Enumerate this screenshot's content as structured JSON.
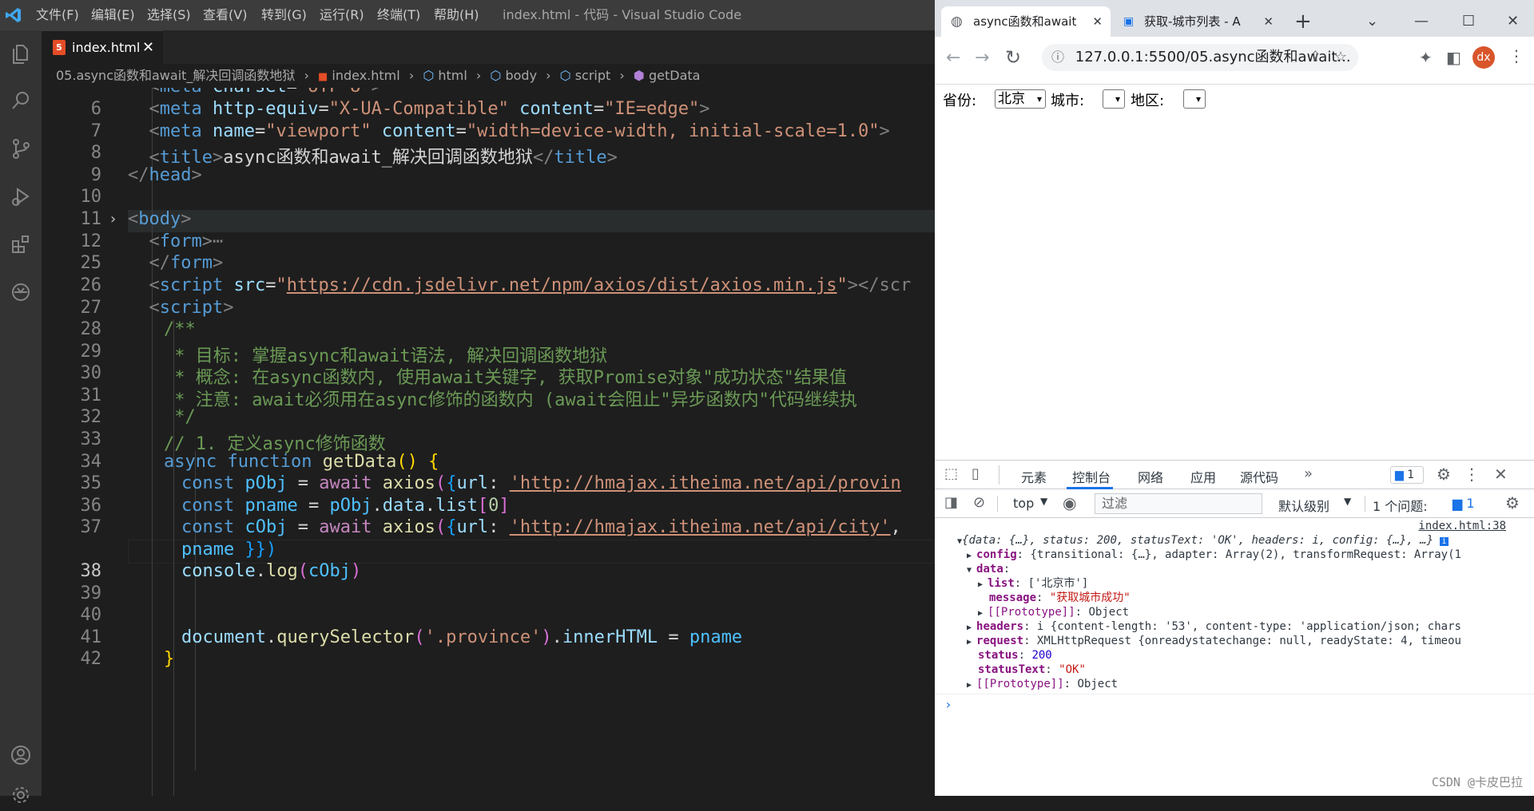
{
  "vscode": {
    "window_title": "index.html - 代码 - Visual Studio Code",
    "menu": [
      "文件(F)",
      "编辑(E)",
      "选择(S)",
      "查看(V)",
      "转到(G)",
      "运行(R)",
      "终端(T)",
      "帮助(H)"
    ],
    "tab": {
      "label": "index.html"
    },
    "breadcrumb": [
      "05.async函数和await_解决回调函数地狱",
      "index.html",
      "html",
      "body",
      "script",
      "getData"
    ],
    "line_numbers": [
      "6",
      "7",
      "8",
      "9",
      "10",
      "11",
      "12",
      "25",
      "26",
      "27",
      "28",
      "29",
      "30",
      "31",
      "32",
      "33",
      "34",
      "35",
      "36",
      "37",
      "",
      "38",
      "39",
      "40",
      "41",
      "42"
    ],
    "current_line": "38",
    "code": {
      "l6": {
        "tag": "meta",
        "a1": "http-equiv",
        "v1": "\"X-UA-Compatible\"",
        "a2": "content",
        "v2": "\"IE=edge\""
      },
      "l7": {
        "tag": "meta",
        "a1": "name",
        "v1": "\"viewport\"",
        "a2": "content",
        "v2": "\"width=device-width, initial-scale=1.0\""
      },
      "l8": {
        "tag": "title",
        "text": "async函数和await_解决回调函数地狱"
      },
      "l9": {
        "tag": "head"
      },
      "l11": {
        "tag": "body"
      },
      "l12": {
        "tag": "form",
        "fold": "⋯"
      },
      "l25": {
        "tag": "form"
      },
      "l26": {
        "tag": "script",
        "attr": "src",
        "url": "https://cdn.jsdelivr.net/npm/axios/dist/axios.min.js",
        "tail": "></scr"
      },
      "l27": {
        "tag": "script"
      },
      "l28": "/**",
      "l29": " * 目标: 掌握async和await语法, 解决回调函数地狱",
      "l30": " * 概念: 在async函数内, 使用await关键字, 获取Promise对象\"成功状态\"结果值",
      "l31": " * 注意: await必须用在async修饰的函数内 (await会阻止\"异步函数内\"代码继续执",
      "l32": " */",
      "l33": "// 1. 定义async修饰函数",
      "l34": {
        "kw1": "async",
        "kw2": "function",
        "fn": "getData",
        "tail": "() {"
      },
      "l35": {
        "kw": "const",
        "var": "pObj",
        "aw": "await",
        "fn": "axios",
        "key": "url",
        "url": "'http://hmajax.itheima.net/api/provin"
      },
      "l36": {
        "kw": "const",
        "var": "pname",
        "expr1": "pObj",
        "expr2": "data",
        "expr3": "list",
        "idx": "0"
      },
      "l37": {
        "kw": "const",
        "var": "cObj",
        "aw": "await",
        "fn": "axios",
        "key": "url",
        "url": "'http://hmajax.itheima.net/api/city'",
        "tail": ","
      },
      "l37b": {
        "var": "pname",
        "tail": "}})"
      },
      "l38": {
        "obj": "console",
        "fn": "log",
        "arg": "cObj"
      },
      "l41": {
        "obj": "document",
        "fn": "querySelector",
        "arg": "'.province'",
        "prop": "innerHTML",
        "val": "pname"
      },
      "l42": "}"
    }
  },
  "browser": {
    "tabs": [
      {
        "title": "async函数和await",
        "active": true
      },
      {
        "title": "获取-城市列表 - A",
        "active": false
      }
    ],
    "address": "127.0.0.1:5500/05.async函数和await...",
    "profile": "dx",
    "page": {
      "province_label": "省份:",
      "province_value": "北京",
      "city_label": "城市:",
      "city_value": "",
      "area_label": "地区:",
      "area_value": ""
    }
  },
  "devtools": {
    "tabs": [
      "元素",
      "控制台",
      "网络",
      "应用",
      "源代码"
    ],
    "active_tab": "控制台",
    "message_badge": "1",
    "context": "top",
    "filter_placeholder": "过滤",
    "levels": "默认级别",
    "issues": "1 个问题:",
    "issues_badge": "1",
    "source_link": "index.html:38",
    "log": {
      "summary": "{data: {…}, status: 200, statusText: 'OK', headers: i, config: {…}, …}",
      "config": "{transitional: {…}, adapter: Array(2), transformRequest: Array(1",
      "list": "['北京市']",
      "message": "\"获取城市成功\"",
      "data_proto": "Object",
      "headers": "i {content-length: '53', content-type: 'application/json; chars",
      "request": "XMLHttpRequest {onreadystatechange: null, readyState: 4, timeou",
      "status": "200",
      "statusText": "\"OK\"",
      "proto": "Object"
    }
  },
  "watermark": "CSDN @卡皮巴拉"
}
